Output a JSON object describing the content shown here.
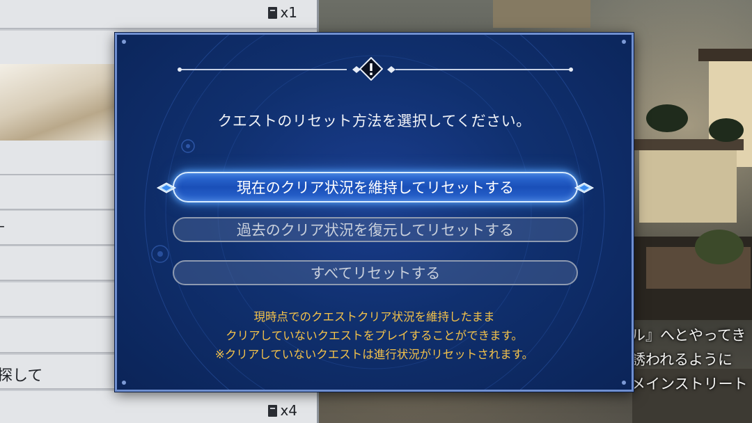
{
  "left_list": {
    "top_count": "x1",
    "dash_text": "–",
    "search_text": "探して",
    "bottom_count": "x4"
  },
  "scene_text": {
    "line1": "ル』へとやってき",
    "line2": "誘われるように",
    "line3": "メインストリート"
  },
  "dialog": {
    "badge_icon": "exclamation-icon",
    "title": "クエストのリセット方法を選択してください。",
    "options": [
      {
        "label": "現在のクリア状況を維持してリセットする",
        "selected": true
      },
      {
        "label": "過去のクリア状況を復元してリセットする",
        "selected": false
      },
      {
        "label": "すべてリセットする",
        "selected": false
      }
    ],
    "description": [
      "現時点でのクエストクリア状況を維持したまま",
      "クリアしていないクエストをプレイすることができます。",
      "※クリアしていないクエストは進行状況がリセットされます。"
    ]
  },
  "colors": {
    "dialog_bg": "#10306f",
    "selected_glow": "#59a5ff",
    "description_text": "#f4c24a"
  }
}
